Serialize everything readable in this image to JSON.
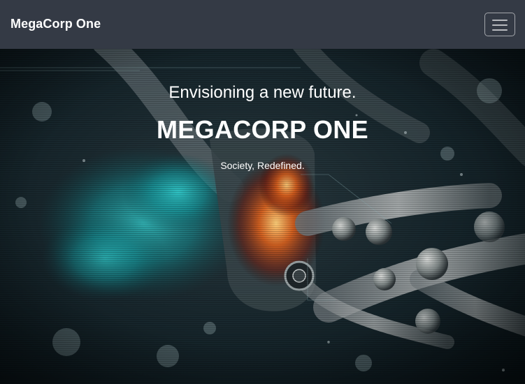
{
  "navbar": {
    "brand": "MegaCorp One",
    "toggle_icon": "hamburger-menu-icon"
  },
  "hero": {
    "tagline": "Envisioning a new future.",
    "headline": "MEGACORP ONE",
    "subline": "Society, Redefined."
  },
  "colors": {
    "navbar_bg": "#343a45",
    "text": "#ffffff",
    "accent_teal": "#1fb5b8",
    "accent_orange": "#e0621c"
  }
}
